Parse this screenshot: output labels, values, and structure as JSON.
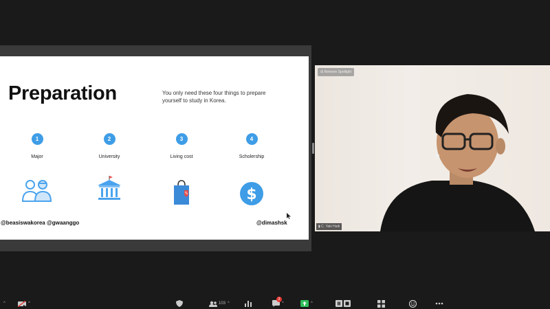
{
  "slide": {
    "title": "Preparation",
    "subtitle": "You only need these four things to prepare yourself to study in Korea.",
    "steps": [
      {
        "num": "1",
        "label": "Major"
      },
      {
        "num": "2",
        "label": "University"
      },
      {
        "num": "3",
        "label": "Living cost"
      },
      {
        "num": "4",
        "label": "Scholership"
      }
    ],
    "handles": {
      "left": "@beasiswakorea  @gwaanggo",
      "right": "@dimashsk"
    }
  },
  "video": {
    "spotlight_label": "Remove Spotlight",
    "participant_name": "C. Yaki Haiti"
  },
  "toolbar": {
    "participants_count": "103",
    "chat_badge": "2"
  },
  "colors": {
    "accent_blue": "#3e9de6",
    "icon_blue": "#4aa3ee",
    "bag_blue": "#3b8ad8",
    "tag_red": "#e54b4b",
    "share_green": "#2fbf5a",
    "background": "#1a1a1a"
  }
}
